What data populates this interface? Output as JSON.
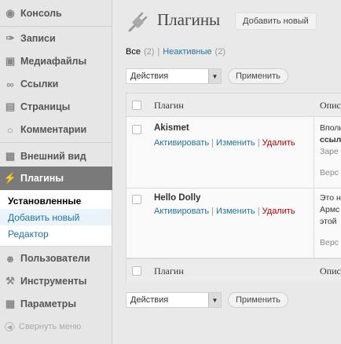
{
  "sidebar": {
    "items": [
      {
        "label": "Консоль",
        "icon": "dashboard-icon"
      },
      {
        "label": "Записи",
        "icon": "pin-icon"
      },
      {
        "label": "Медиафайлы",
        "icon": "media-icon"
      },
      {
        "label": "Ссылки",
        "icon": "link-icon"
      },
      {
        "label": "Страницы",
        "icon": "page-icon"
      },
      {
        "label": "Комментарии",
        "icon": "comment-icon"
      },
      {
        "label": "Внешний вид",
        "icon": "appearance-icon"
      },
      {
        "label": "Плагины",
        "icon": "plugin-icon"
      },
      {
        "label": "Пользователи",
        "icon": "users-icon"
      },
      {
        "label": "Инструменты",
        "icon": "tools-icon"
      },
      {
        "label": "Параметры",
        "icon": "settings-icon"
      }
    ],
    "submenu": [
      "Установленные",
      "Добавить новый",
      "Редактор"
    ],
    "collapse_label": "Свернуть меню"
  },
  "header": {
    "title": "Плагины",
    "add_new": "Добавить новый"
  },
  "filters": {
    "all_label": "Все",
    "all_count": "(2)",
    "separator": "|",
    "inactive_label": "Неактивные",
    "inactive_count": "(2)"
  },
  "bulk": {
    "select_value": "Действия",
    "apply_label": "Применить"
  },
  "table": {
    "col_plugin": "Плагин",
    "col_desc": "Опис",
    "rows": [
      {
        "name": "Akismet",
        "activate": "Активировать",
        "edit": "Изменить",
        "delete": "Удалить",
        "desc_lines": [
          "Вполн",
          "ссыл",
          "Заре",
          "Верс"
        ]
      },
      {
        "name": "Hello Dolly",
        "activate": "Активировать",
        "edit": "Изменить",
        "delete": "Удалить",
        "desc_lines": [
          "Это н",
          "Армс",
          "этой",
          "Верс"
        ]
      }
    ]
  }
}
